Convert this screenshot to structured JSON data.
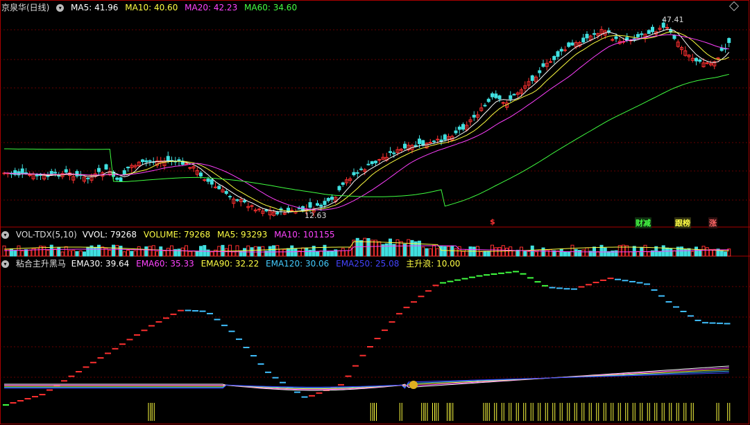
{
  "main": {
    "title": "京泉华(日线)",
    "ma": [
      {
        "label": "MA5: 41.96",
        "color": "#ffffff"
      },
      {
        "label": "MA10: 40.60",
        "color": "#ffff40"
      },
      {
        "label": "MA20: 42.23",
        "color": "#ff40ff"
      },
      {
        "label": "MA60: 34.60",
        "color": "#40ff40"
      }
    ],
    "high_label": "47.41",
    "low_label": "12.63",
    "signals": [
      {
        "text": "$",
        "color": "#ff3030",
        "bg": "transparent"
      },
      {
        "text": "财减",
        "color": "#40ff40",
        "bg": "#103010"
      },
      {
        "text": "跟榜",
        "color": "#ffff40",
        "bg": "#303010"
      },
      {
        "text": "涨",
        "color": "#ff6060",
        "bg": "#301010"
      }
    ]
  },
  "vol": {
    "title": "VOL-TDX(5,10)",
    "items": [
      {
        "label": "VVOL: 79268",
        "color": "#ffffff"
      },
      {
        "label": "VOLUME: 79268",
        "color": "#ffff40"
      },
      {
        "label": "MA5: 93293",
        "color": "#ffff40"
      },
      {
        "label": "MA10: 101155",
        "color": "#ff40ff"
      }
    ]
  },
  "ind": {
    "title": "粘合主升黑马",
    "items": [
      {
        "label": "EMA30: 39.64",
        "color": "#ffffff"
      },
      {
        "label": "EMA60: 35.33",
        "color": "#ff40ff"
      },
      {
        "label": "EMA90: 32.22",
        "color": "#ffff40"
      },
      {
        "label": "EMA120: 30.06",
        "color": "#40c0ff"
      },
      {
        "label": "EMA250: 25.08",
        "color": "#4040ff"
      },
      {
        "label": "主升浪: 10.00",
        "color": "#ffff40"
      }
    ]
  },
  "colors": {
    "up": "#ff3030",
    "down": "#40e0e0",
    "ma5": "#ffffff",
    "ma10": "#ffff40",
    "ma20": "#ff40ff",
    "ma60": "#40ff40"
  }
}
